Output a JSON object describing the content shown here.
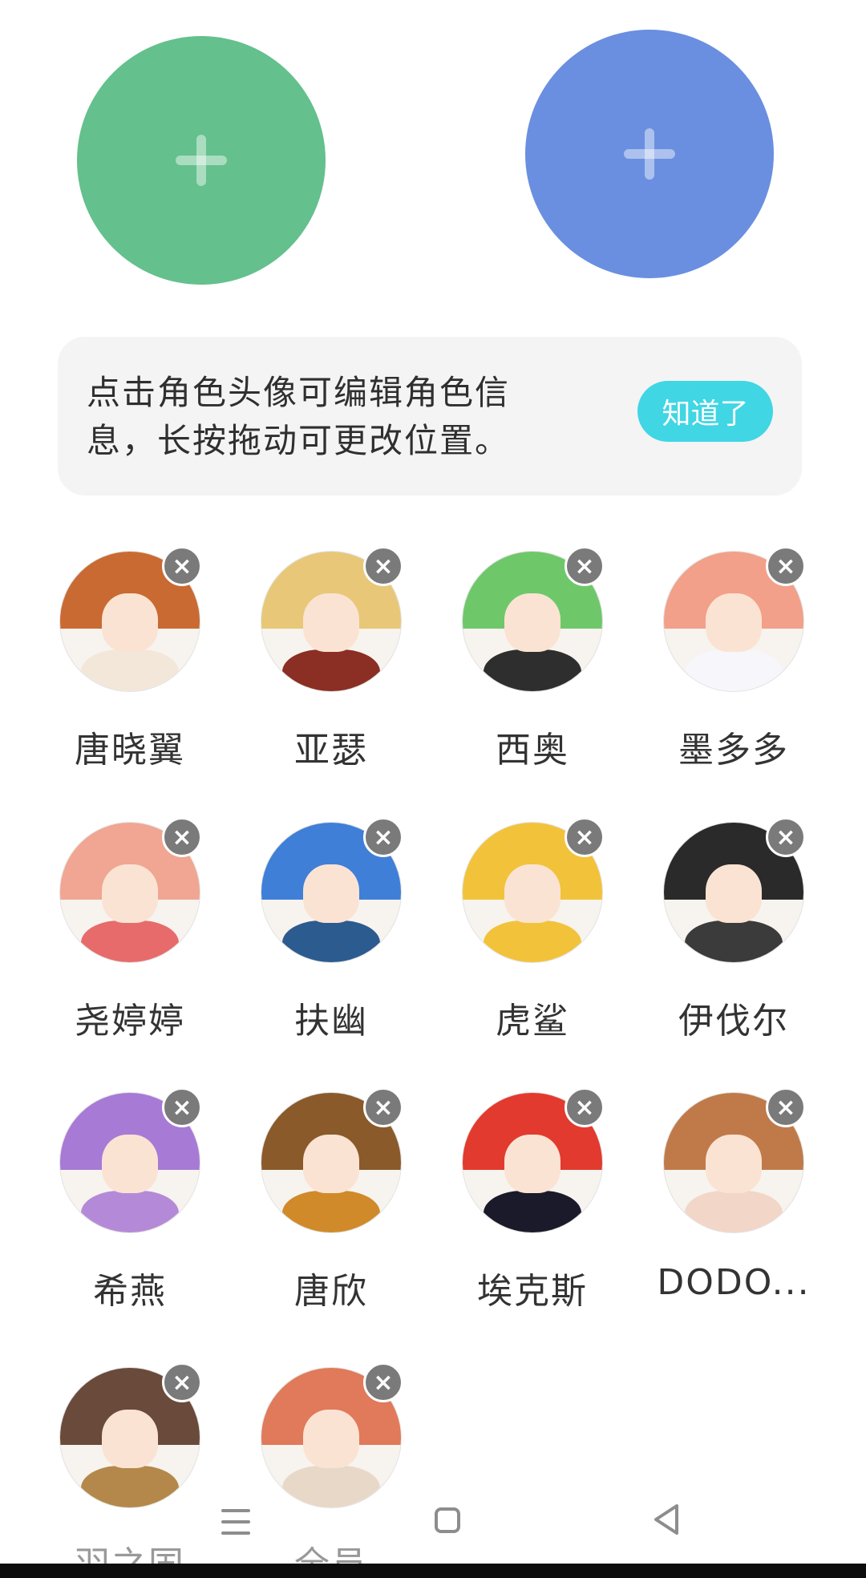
{
  "top_buttons": {
    "left": {
      "symbol": "+",
      "color": "#64c08d"
    },
    "right": {
      "symbol": "+",
      "color": "#6a8fe0"
    }
  },
  "tip": {
    "text": "点击角色头像可编辑角色信息，长按拖动可更改位置。",
    "button_label": "知道了",
    "button_color": "#40d6e4"
  },
  "delete_symbol": "×",
  "characters": [
    {
      "name": "唐晓翼",
      "hair": "#c96a32",
      "body": "#f3e7da"
    },
    {
      "name": "亚瑟",
      "hair": "#e8c878",
      "body": "#8b2e24"
    },
    {
      "name": "西奥",
      "hair": "#6ec86a",
      "body": "#2e2e2e"
    },
    {
      "name": "墨多多",
      "hair": "#f2a08a",
      "body": "#f6f6fb"
    },
    {
      "name": "尧婷婷",
      "hair": "#f0a692",
      "body": "#e76b6b"
    },
    {
      "name": "扶幽",
      "hair": "#3f7fd8",
      "body": "#2c5b8f"
    },
    {
      "name": "虎鲨",
      "hair": "#f2c23a",
      "body": "#f2c23a"
    },
    {
      "name": "伊伐尔",
      "hair": "#2a2a2a",
      "body": "#3b3b3b"
    },
    {
      "name": "希燕",
      "hair": "#a77ad6",
      "body": "#b48ad8"
    },
    {
      "name": "唐欣",
      "hair": "#8a5a2a",
      "body": "#d08a2a"
    },
    {
      "name": "埃克斯",
      "hair": "#e23a2e",
      "body": "#1a1a2a"
    },
    {
      "name": "DODO...",
      "hair": "#c07a4a",
      "body": "#f2d6c8"
    },
    {
      "name": "羽之国",
      "hair": "#6a4a3a",
      "body": "#b4884a"
    },
    {
      "name": "全员",
      "hair": "#e07a5a",
      "body": "#e8d8c8"
    }
  ]
}
